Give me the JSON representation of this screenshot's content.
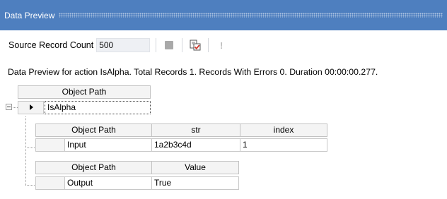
{
  "window": {
    "title": "Data Preview"
  },
  "toolbar": {
    "source_count_label": "Source Record Count",
    "source_count_value": "500",
    "stop_icon": "stop-icon",
    "export_icon": "preview-check-icon",
    "info_icon": "exclamation-icon"
  },
  "status": {
    "text": "Data Preview for action IsAlpha. Total Records 1. Records With Errors 0. Duration 00:00:00.277."
  },
  "grid": {
    "top": {
      "columns": [
        "Object Path"
      ],
      "rows": [
        [
          "IsAlpha"
        ]
      ]
    },
    "inputs": {
      "columns": [
        "Object Path",
        "str",
        "index"
      ],
      "rows": [
        [
          "Input",
          "1a2b3c4d",
          "1"
        ]
      ]
    },
    "outputs": {
      "columns": [
        "Object Path",
        "Value"
      ],
      "rows": [
        [
          "Output",
          "True"
        ]
      ]
    }
  },
  "colors": {
    "titlebar": "#4e7fbf",
    "header_bg": "#f4f4f4",
    "grid_border": "#c8c8c8"
  }
}
